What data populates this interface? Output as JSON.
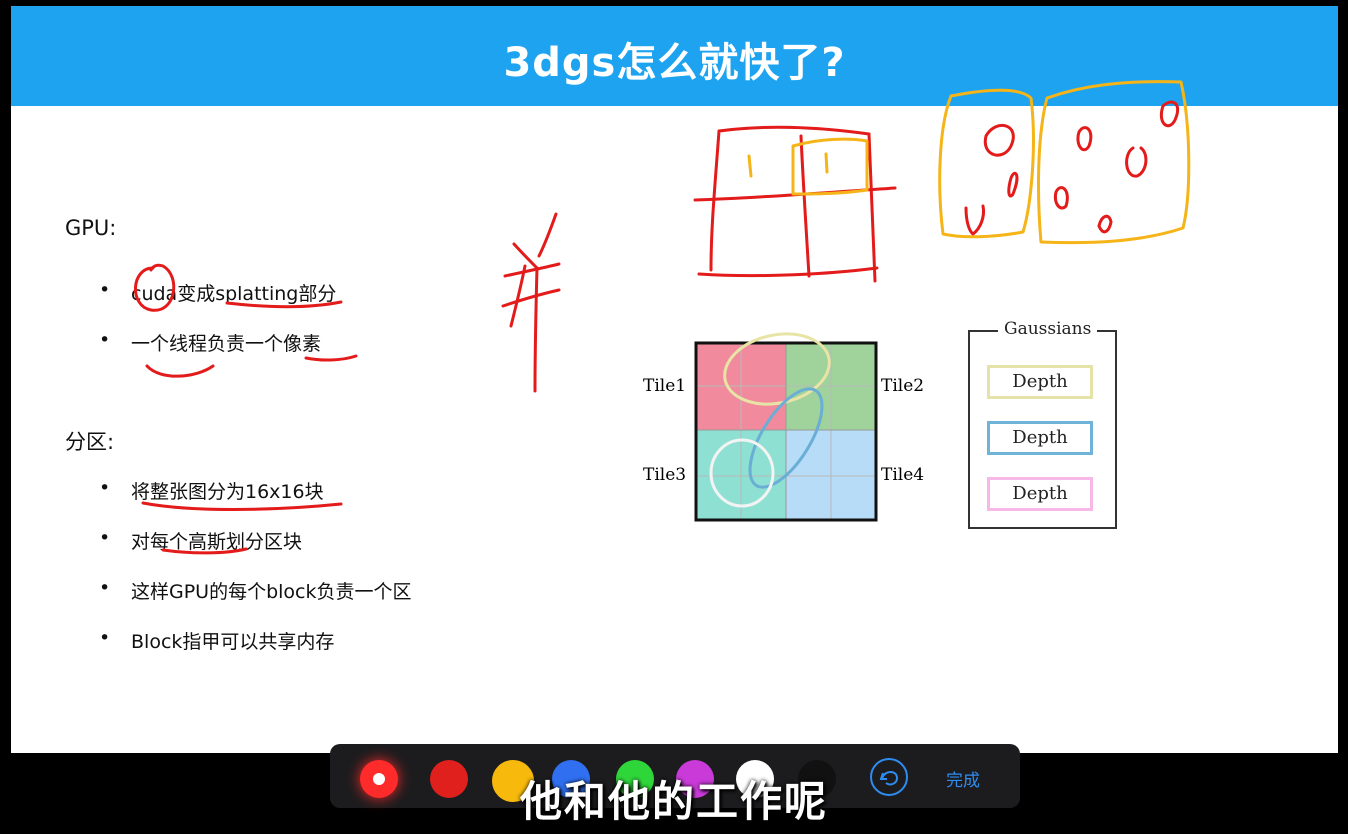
{
  "slide": {
    "title": "3dgs怎么就快了?",
    "section1": {
      "heading": "GPU:",
      "items": [
        "cuda变成splatting部分",
        "一个线程负责一个像素"
      ]
    },
    "section2": {
      "heading": "分区:",
      "items": [
        "将整张图分为16x16块",
        "对每个高斯划分区块",
        "这样GPU的每个block负责一个区",
        "Block指甲可以共享内存"
      ]
    },
    "figure": {
      "tiles": [
        "Tile1",
        "Tile2",
        "Tile3",
        "Tile4"
      ],
      "tile_colors": [
        "#f08a9c",
        "#9fd39b",
        "#8ee0d3",
        "#b7dcf7"
      ],
      "legend_title": "Gaussians",
      "depth_labels": [
        "Depth",
        "Depth",
        "Depth"
      ],
      "depth_colors": [
        "#e6e3a8",
        "#6fb3d8",
        "#f6b8e6"
      ]
    }
  },
  "toolbar": {
    "colors": [
      "#ff2a2a",
      "#e0201c",
      "#f6b90c",
      "#2f6ff0",
      "#2fd63a",
      "#c93ad8",
      "#ffffff",
      "#111111"
    ],
    "undo_icon": "undo-icon",
    "done_label": "完成"
  },
  "subtitle": "他和他的工作呢"
}
